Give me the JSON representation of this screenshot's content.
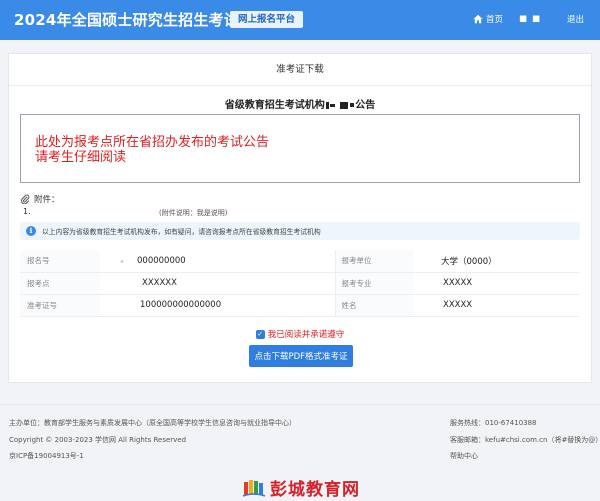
{
  "header": {
    "title": "2024年全国硕士研究生招生考试",
    "platform": "网上报名平台",
    "home": "首页",
    "user": "■ ■",
    "logout": "退出"
  },
  "card": {
    "title": "准考证下载",
    "notice_title_prefix": "省级教育招生考试机构",
    "notice_title_suffix": "公告",
    "notice_lines": [
      "此处为报考点所在省招办发布的考试公告",
      "请考生仔细阅读"
    ],
    "attachments_label": "附件：",
    "attachment_index": "1.",
    "attachment_note": "(附件说明：我是说明)",
    "info_text": "以上内容为省级教育招生考试机构发布，如有疑问，请咨询报考点所在省级教育招生考试机构",
    "ticket": {
      "rows": [
        {
          "l1": "报名号",
          "v1": "000000000",
          "l2": "报考单位",
          "v2": "大学（0000）"
        },
        {
          "l1": "报考点",
          "v1": "XXXXXX",
          "l2": "报考专业",
          "v2": "XXXXX"
        },
        {
          "l1": "准考证号",
          "v1": "100000000000000",
          "l2": "姓名",
          "v2": "XXXXX"
        }
      ]
    },
    "agree_label": "我已阅读并承诺遵守",
    "download_label": "点击下载PDF格式准考证"
  },
  "footer": {
    "sponsor": "主办单位：教育部学生服务与素质发展中心（原全国高等学校学生信息咨询与就业指导中心）",
    "copyright": "Copyright © 2003-2023 学信网 All Rights Reserved",
    "icp": "京ICP备19004913号-1",
    "hotline": "服务热线：010-67410388",
    "email": "客服邮箱：kefu#chsi.com.cn（将#替换为@）",
    "help": "帮助中心",
    "logo_text": "彭城教育网"
  },
  "colors": {
    "header_bg": "#3a8be8",
    "accent": "#2f7ee0",
    "notice_red": "#e02020"
  }
}
